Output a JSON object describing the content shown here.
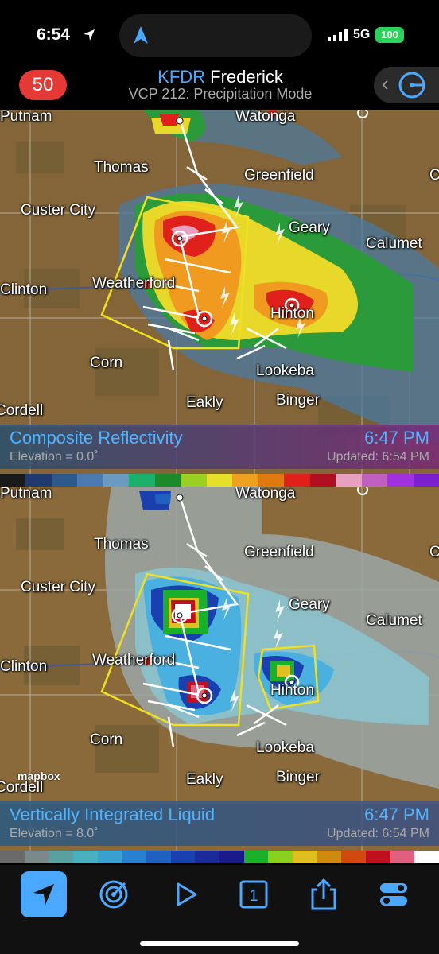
{
  "status_bar": {
    "time": "6:54",
    "network": "5G",
    "battery": "100"
  },
  "header": {
    "alert_count": "50",
    "station_code": "KFDR",
    "station_name": "Frederick",
    "vcp": "VCP 212: Precipitation Mode"
  },
  "panels": [
    {
      "product": "Composite Reflectivity",
      "scan_time": "6:47 PM",
      "elevation": "Elevation = 0.0˚",
      "updated": "Updated: 6:54 PM",
      "scale_colors": [
        "#1a1a1a",
        "#1e3a6e",
        "#2d5a8a",
        "#4a7ab0",
        "#6a9ac0",
        "#1ab06a",
        "#1a8a2a",
        "#9ad022",
        "#e6e02a",
        "#f0a020",
        "#e07a10",
        "#e0201a",
        "#b01020",
        "#e8a0c0",
        "#c060c0",
        "#a030e0",
        "#7a20d0"
      ]
    },
    {
      "product": "Vertically Integrated Liquid",
      "scan_time": "6:47 PM",
      "elevation": "Elevation = 8.0˚",
      "updated": "Updated: 6:54 PM",
      "scale_colors": [
        "#6a6a6a",
        "#7a8a8a",
        "#5aa0a0",
        "#4ab0c0",
        "#3aa0d0",
        "#2a80d0",
        "#2060c0",
        "#1a40b0",
        "#1a2a9a",
        "#1a1a8a",
        "#1ab02a",
        "#8ad020",
        "#e0c020",
        "#d08a10",
        "#d04a10",
        "#c01020",
        "#e06080",
        "#ffffff"
      ],
      "attribution": "mapbox"
    }
  ],
  "map_labels": {
    "watonga": "Watonga",
    "putnam": "Putnam",
    "thomas": "Thomas",
    "greenfield": "Greenfield",
    "custer_city": "Custer City",
    "geary": "Geary",
    "calumet": "Calumet",
    "clinton": "Clinton",
    "weatherford": "Weatherford",
    "hinton": "Hinton",
    "corn": "Corn",
    "lookeba": "Lookeba",
    "eakly": "Eakly",
    "binger": "Binger",
    "cordell": "Cordell",
    "edge_o": "O"
  },
  "toolbar": [
    "location-arrow-icon",
    "radar-icon",
    "play-icon",
    "one-icon",
    "share-icon",
    "settings-icon"
  ]
}
